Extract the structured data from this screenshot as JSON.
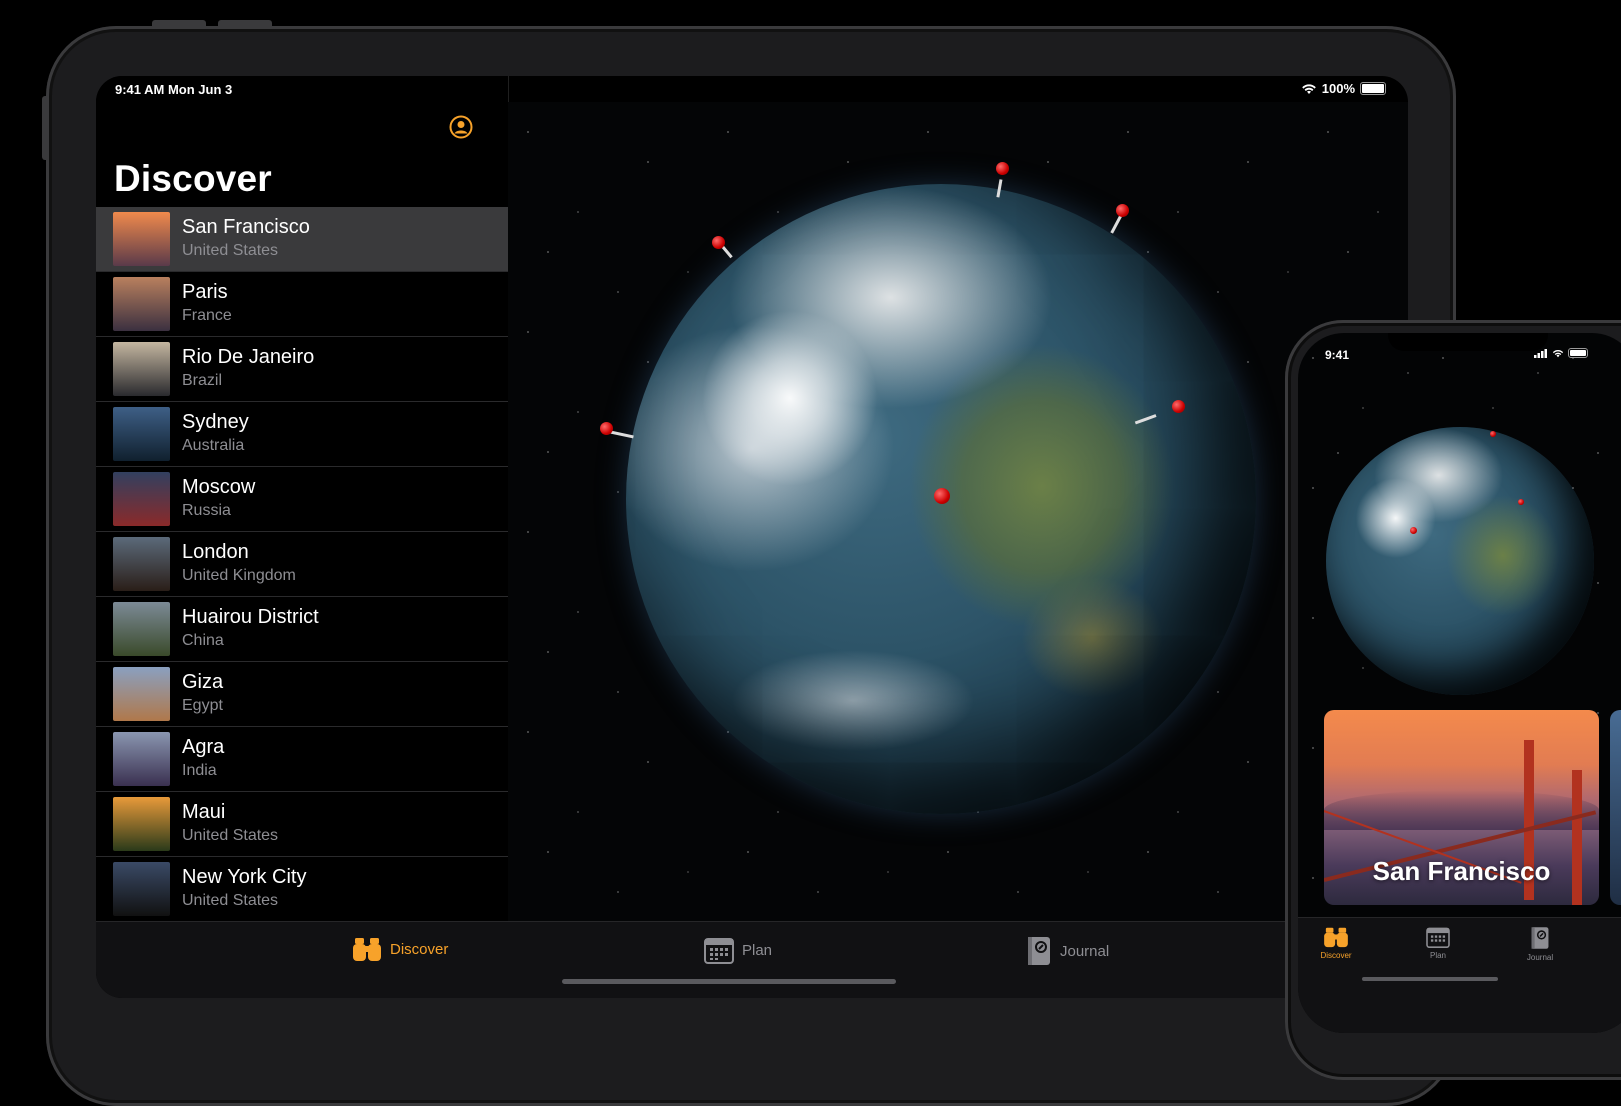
{
  "ipad": {
    "status": {
      "time": "9:41 AM  Mon Jun 3",
      "battery": "100%"
    },
    "title": "Discover",
    "locations": [
      {
        "city": "San Francisco",
        "country": "United States",
        "selected": true,
        "thumb": [
          "#f08a4c",
          "#5a3a4a"
        ]
      },
      {
        "city": "Paris",
        "country": "France",
        "selected": false,
        "thumb": [
          "#b9805e",
          "#3b3040"
        ]
      },
      {
        "city": "Rio De Janeiro",
        "country": "Brazil",
        "selected": false,
        "thumb": [
          "#c4b6a0",
          "#2a2a2e"
        ]
      },
      {
        "city": "Sydney",
        "country": "Australia",
        "selected": false,
        "thumb": [
          "#3e5f86",
          "#10202e"
        ]
      },
      {
        "city": "Moscow",
        "country": "Russia",
        "selected": false,
        "thumb": [
          "#324060",
          "#8a2a2a"
        ]
      },
      {
        "city": "London",
        "country": "United Kingdom",
        "selected": false,
        "thumb": [
          "#5b6a7a",
          "#2a1e18"
        ]
      },
      {
        "city": "Huairou District",
        "country": "China",
        "selected": false,
        "thumb": [
          "#7c8a96",
          "#3a4a2a"
        ]
      },
      {
        "city": "Giza",
        "country": "Egypt",
        "selected": false,
        "thumb": [
          "#8aa0c0",
          "#b0784a"
        ]
      },
      {
        "city": "Agra",
        "country": "India",
        "selected": false,
        "thumb": [
          "#8a96b0",
          "#3a3050"
        ]
      },
      {
        "city": "Maui",
        "country": "United States",
        "selected": false,
        "thumb": [
          "#e89a3a",
          "#2a3a1a"
        ]
      },
      {
        "city": "New York City",
        "country": "United States",
        "selected": false,
        "thumb": [
          "#3a4a66",
          "#111"
        ]
      }
    ],
    "tabs": [
      {
        "label": "Discover",
        "icon": "binoculars-icon",
        "active": true
      },
      {
        "label": "Plan",
        "icon": "calendar-icon",
        "active": false
      },
      {
        "label": "Journal",
        "icon": "journal-icon",
        "active": false
      }
    ]
  },
  "iphone": {
    "status": {
      "time": "9:41"
    },
    "card_title": "San Francisco",
    "tabs": [
      {
        "label": "Discover",
        "icon": "binoculars-icon",
        "active": true
      },
      {
        "label": "Plan",
        "icon": "calendar-icon",
        "active": false
      },
      {
        "label": "Journal",
        "icon": "journal-icon",
        "active": false
      }
    ]
  },
  "colors": {
    "accent": "#f7a22a",
    "selected_row": "#3a3a3c",
    "secondary_text": "#8e8e93"
  }
}
